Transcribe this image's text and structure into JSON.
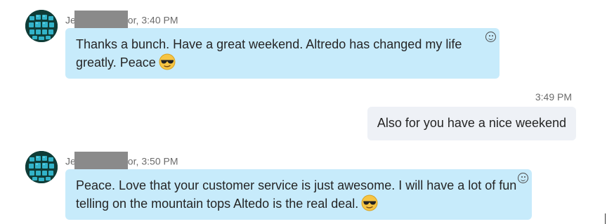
{
  "messages": [
    {
      "sender_prefix": "Je",
      "sender_suffix": "or",
      "time": "3:40 PM",
      "text": "Thanks a bunch. Have a great weekend. Altredo has changed my life greatly. Peace",
      "emoji": "sunglasses-emoji"
    },
    {
      "time": "3:49 PM",
      "text": "Also for you have a nice weekend"
    },
    {
      "sender_prefix": "Je",
      "sender_suffix": "or",
      "time": "3:50 PM",
      "text": "Peace. Love that your customer service is just awesome. I will have a lot of fun telling on the mountain tops Altedo is the real deal.",
      "emoji": "sunglasses-emoji"
    }
  ],
  "colors": {
    "incoming_bubble": "#c7ebfb",
    "outgoing_bubble": "#eef1f6",
    "meta_text": "#6b6b6b",
    "message_text": "#252525"
  },
  "icons": [
    "avatar",
    "sunglasses-emoji",
    "add-reaction-icon",
    "redacted-name-block"
  ]
}
